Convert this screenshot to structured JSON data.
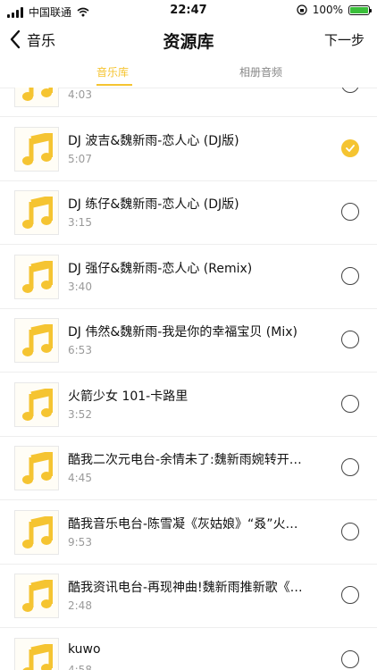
{
  "status": {
    "carrier": "中国联通",
    "time": "22:47",
    "battery": "100%",
    "battery_level": 1.0
  },
  "nav": {
    "back_label": "音乐",
    "title": "资源库",
    "next_label": "下一步"
  },
  "tabs": [
    {
      "label": "音乐库",
      "active": true
    },
    {
      "label": "相册音频",
      "active": false
    }
  ],
  "songs": [
    {
      "title": "",
      "duration": "4:03",
      "checked": false
    },
    {
      "title": "DJ 波吉&魏新雨-恋人心 (DJ版)",
      "duration": "5:07",
      "checked": true
    },
    {
      "title": "DJ 练仔&魏新雨-恋人心 (DJ版)",
      "duration": "3:15",
      "checked": false
    },
    {
      "title": "DJ 强仔&魏新雨-恋人心 (Remix)",
      "duration": "3:40",
      "checked": false
    },
    {
      "title": "DJ 伟然&魏新雨-我是你的幸福宝贝 (Mix)",
      "duration": "6:53",
      "checked": false
    },
    {
      "title": "火箭少女 101-卡路里",
      "duration": "3:52",
      "checked": false
    },
    {
      "title": "酷我二次元电台-余情未了:魏新雨婉转开…",
      "duration": "4:45",
      "checked": false
    },
    {
      "title": "酷我音乐电台-陈雪凝《灰姑娘》“叒”火…",
      "duration": "9:53",
      "checked": false
    },
    {
      "title": "酷我资讯电台-再现神曲!魏新雨推新歌《…",
      "duration": "2:48",
      "checked": false
    },
    {
      "title": "kuwo",
      "duration": "4:58",
      "checked": false
    }
  ],
  "icons": {
    "cover": "music-note-icon",
    "accent_color": "#f5c431"
  }
}
